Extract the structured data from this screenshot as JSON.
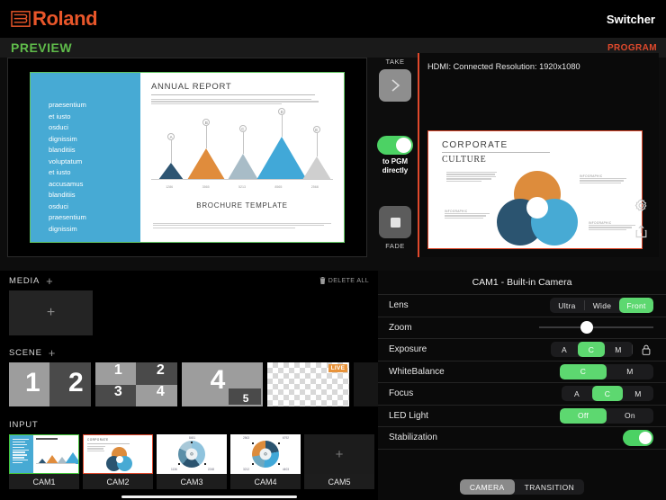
{
  "header": {
    "brand": "Roland",
    "brand_color": "#e8562a",
    "app_mode": "Switcher"
  },
  "monitors": {
    "preview_label": "PREVIEW",
    "program_label": "PROGRAM",
    "preview_border_color": "#62c462",
    "program_border_color": "#e0492c",
    "program_status": "HDMI:  Connected   Resolution: 1920x1080",
    "preview_slide": {
      "left_panel_text": [
        "praesentium",
        "et iusto",
        "osduci",
        "dignissim",
        "blanditiis",
        "voluptatum",
        "et iusto",
        "accusamus",
        "blanditiis",
        "osduci",
        "praesentium",
        "dignissim"
      ],
      "title": "ANNUAL REPORT",
      "footer_title": "BROCHURE TEMPLATE",
      "chart_bubbles": [
        "A",
        "B",
        "C",
        "D",
        "E"
      ],
      "chart_values": [
        "1286",
        "3565",
        "5213",
        "8565",
        "2568"
      ]
    },
    "program_slide": {
      "title": "CORPORATE",
      "subtitle": "CULTURE",
      "info_labels": [
        "INFOGRAPHIC",
        "INFOGRAPHIC",
        "INFOGRAPHIC"
      ]
    },
    "take": {
      "label": "TAKE",
      "icon": "chevron-right-icon",
      "to_pgm_label_line1": "to PGM",
      "to_pgm_label_line2": "directly",
      "to_pgm_on": true,
      "fade_label": "FADE",
      "fade_icon": "stop-square-icon"
    },
    "side_icons": [
      "gear-icon",
      "share-icon"
    ]
  },
  "media": {
    "title": "MEDIA",
    "add_label": "+",
    "delete_all_label": "DELETE ALL",
    "tile_add_label": "+"
  },
  "scene": {
    "title": "SCENE",
    "add_label": "+",
    "tiles": [
      {
        "name": "split-two",
        "numbers": [
          "1",
          "2"
        ]
      },
      {
        "name": "quad-four",
        "numbers": [
          "1",
          "2",
          "3",
          "4"
        ]
      },
      {
        "name": "pip-two",
        "numbers": [
          "4",
          "5"
        ]
      },
      {
        "name": "transparent",
        "numbers": [],
        "badge": "LIVE"
      }
    ]
  },
  "input": {
    "title": "INPUT",
    "items": [
      {
        "name": "CAM1",
        "selection": "preview",
        "thumb": "annual-report"
      },
      {
        "name": "CAM2",
        "selection": "program",
        "thumb": "corporate-culture"
      },
      {
        "name": "CAM3",
        "selection": "none",
        "thumb": "donut-blue"
      },
      {
        "name": "CAM4",
        "selection": "none",
        "thumb": "donut-orange"
      },
      {
        "name": "CAM5",
        "selection": "none",
        "thumb": "empty-add"
      }
    ],
    "cam3_values": [
      "8451",
      "1136",
      "2248"
    ],
    "cam4_values": [
      "2563",
      "6792",
      "3212",
      "4403"
    ]
  },
  "panel": {
    "title": "CAM1 - Built-in Camera",
    "accent_green": "#5dd870",
    "rows": [
      {
        "label": "Lens",
        "type": "segment",
        "options": [
          "Ultra",
          "Wide",
          "Front"
        ],
        "selected": "Front"
      },
      {
        "label": "Zoom",
        "type": "slider",
        "value": 42
      },
      {
        "label": "Exposure",
        "type": "segment",
        "options": [
          "A",
          "C",
          "M"
        ],
        "selected": "C",
        "lock": "lock-icon"
      },
      {
        "label": "WhiteBalance",
        "type": "segment",
        "options": [
          "C",
          "M"
        ],
        "selected": "C"
      },
      {
        "label": "Focus",
        "type": "segment",
        "options": [
          "A",
          "C",
          "M"
        ],
        "selected": "C"
      },
      {
        "label": "LED Light",
        "type": "segment",
        "options": [
          "Off",
          "On"
        ],
        "selected": "Off"
      },
      {
        "label": "Stabilization",
        "type": "toggle",
        "value": true
      }
    ],
    "mode_tabs": [
      "CAMERA",
      "TRANSITION"
    ],
    "mode_selected": "CAMERA"
  }
}
